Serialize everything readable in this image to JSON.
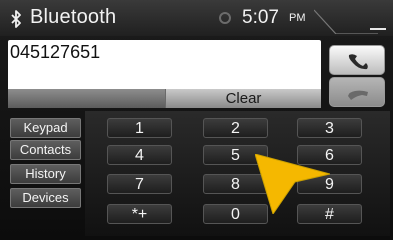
{
  "header": {
    "icon": "bluetooth-icon",
    "title": "Bluetooth",
    "time": "5:07",
    "ampm": "PM"
  },
  "display": {
    "number": "045127651",
    "clear_label": "Clear"
  },
  "call_buttons": {
    "accept_icon": "phone-call-icon",
    "hangup_icon": "phone-hangup-icon"
  },
  "sidebar": {
    "items": [
      {
        "label": "Keypad"
      },
      {
        "label": "Contacts"
      },
      {
        "label": "History"
      },
      {
        "label": "Devices"
      }
    ]
  },
  "keypad": {
    "keys": [
      "1",
      "2",
      "3",
      "4",
      "5",
      "6",
      "7",
      "8",
      "9",
      "*+",
      "0",
      "#"
    ]
  },
  "colors": {
    "pointer": "#f5b800",
    "background": "#101010"
  }
}
